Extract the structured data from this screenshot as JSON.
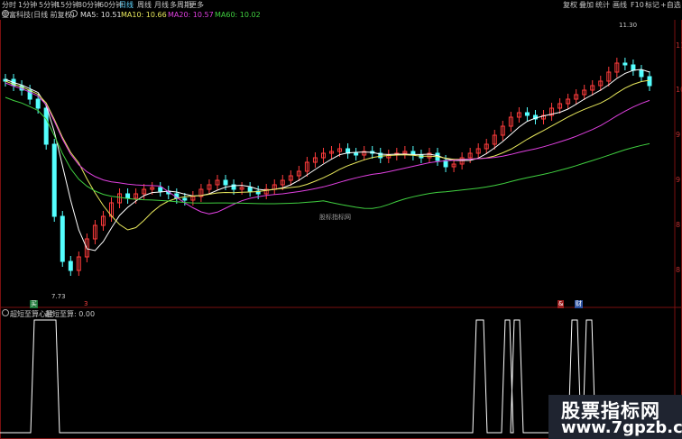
{
  "toolbar": {
    "periods": [
      "分时",
      "1分钟",
      "5分钟",
      "15分钟",
      "30分钟",
      "60分钟",
      "日线",
      "周线",
      "月线",
      "多周期",
      "更多"
    ],
    "active_period": "日线",
    "tools": [
      "复权",
      "叠加",
      "统计",
      "画线",
      "F10",
      "标记",
      "+自选"
    ]
  },
  "info": {
    "stock": "金富科技(日线 前复权)",
    "ma5": "MA5: 10.51",
    "ma10": "MA10: 10.66",
    "ma20": "MA20: 10.57",
    "ma60": "MA60: 10.02"
  },
  "annotations": {
    "high_price": "11.30",
    "low_price": "7.73",
    "watermark": "股标指标网"
  },
  "markers": {
    "m1": "买",
    "m2": "3",
    "m3": "&",
    "m4": "财"
  },
  "sub_panel": {
    "title": "超短至算心胜",
    "value_label": "超短至算: 0.00"
  },
  "logo": {
    "line1": "股票指标网",
    "line2": "www.7gpzb.com"
  },
  "colors": {
    "up": "#ff3c3c",
    "down": "#54ffff",
    "ma5": "#ffffff",
    "ma10": "#e8e85c",
    "ma20": "#e040e0",
    "ma60": "#40d040",
    "indicator": "#ffffff"
  }
}
